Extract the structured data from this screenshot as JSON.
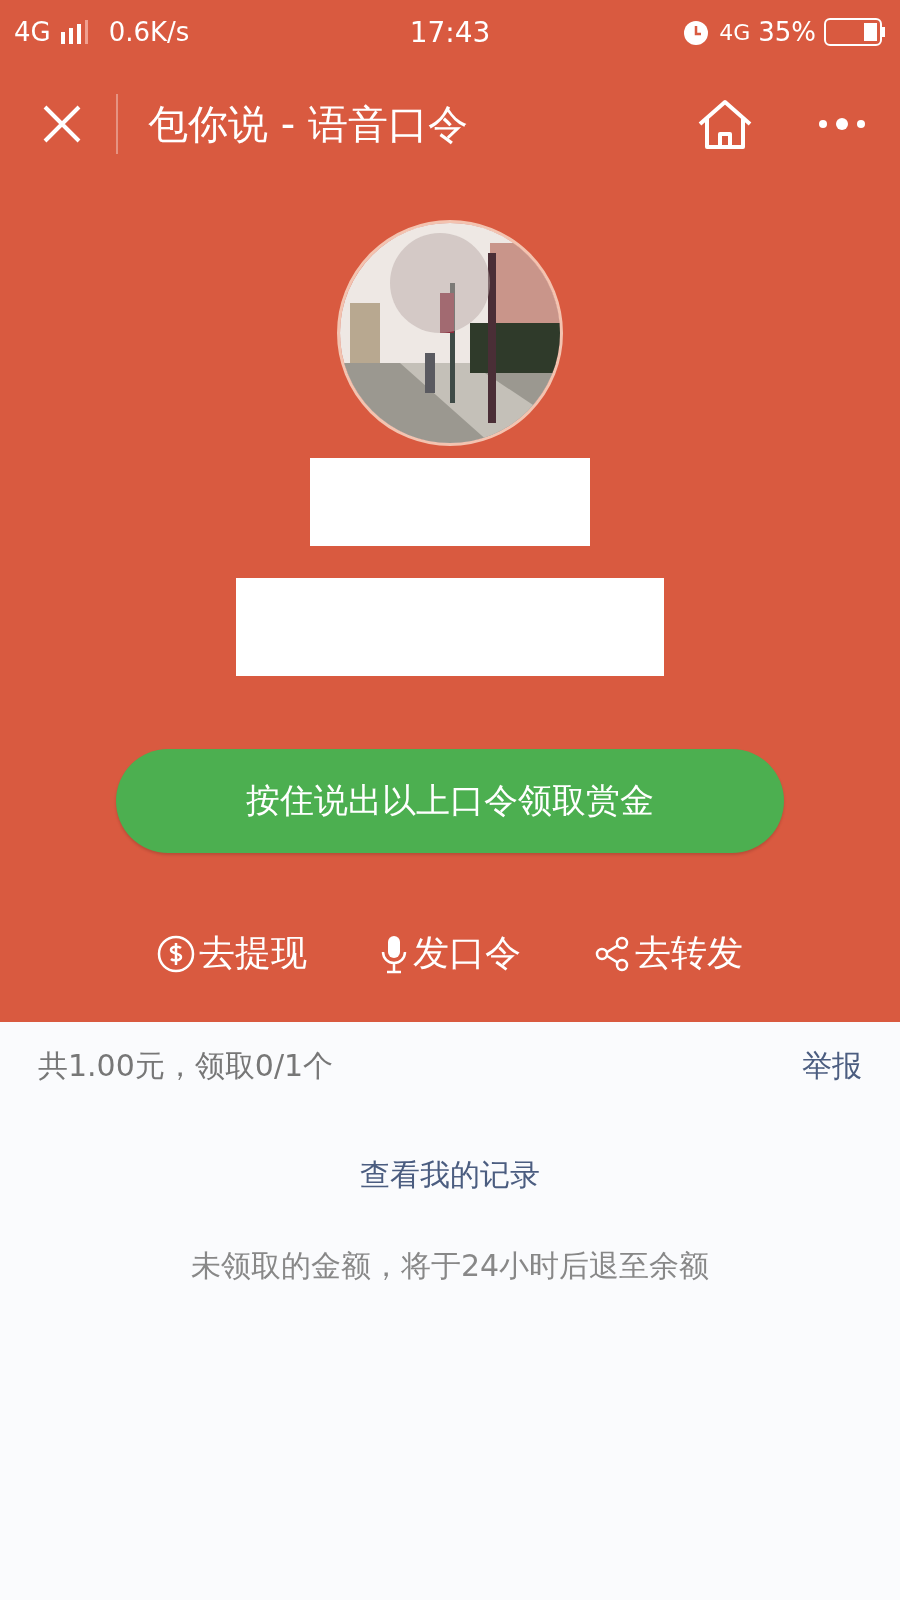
{
  "status_bar": {
    "network": "4G",
    "speed": "0.6K/s",
    "time": "17:43",
    "network_right": "4G",
    "battery": "35%"
  },
  "nav": {
    "title": "包你说 - 语音口令"
  },
  "claim_button": "按住说出以上口令领取赏金",
  "actions": [
    {
      "kind": "dollar",
      "label": "去提现"
    },
    {
      "kind": "mic",
      "label": "发口令"
    },
    {
      "kind": "share",
      "label": "去转发"
    }
  ],
  "summary": "共1.00元，领取0/1个",
  "report_link": "举报",
  "records_link": "查看我的记录",
  "note": "未领取的金额，将于24小时后退至余额"
}
